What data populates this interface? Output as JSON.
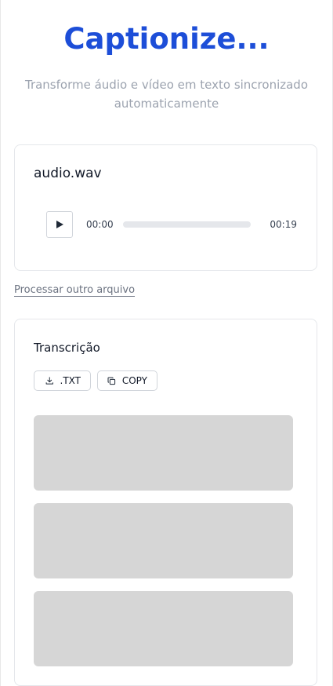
{
  "header": {
    "title": "Captionize...",
    "subtitle": "Transforme áudio e vídeo em texto sincronizado automaticamente"
  },
  "audio_card": {
    "filename": "audio.wav",
    "player": {
      "current_time": "00:00",
      "total_time": "00:19",
      "progress_percent": 0,
      "play_icon": "play-icon"
    }
  },
  "actions": {
    "process_other": "Processar outro arquivo"
  },
  "transcript_card": {
    "title": "Transcrição",
    "download_label": ".TXT",
    "download_icon": "download-icon",
    "copy_label": "COPY",
    "copy_icon": "copy-icon",
    "placeholder_blocks": 3
  },
  "colors": {
    "accent": "#1d4ed8",
    "muted_text": "#9ca3af",
    "skeleton": "#d6d6d6"
  }
}
